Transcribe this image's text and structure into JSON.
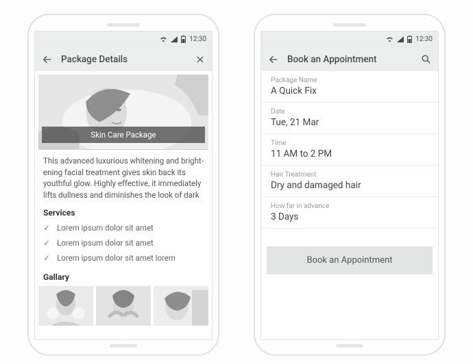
{
  "status": {
    "time": "12:30"
  },
  "left": {
    "appbar": {
      "title": "Package Details"
    },
    "hero": {
      "banner": "Skin Care Package"
    },
    "description": "This advanced luxurious whitening and bright-ening facial treatment gives skin back its youthful glow. Highly effective, it immediately lifts dullness and diminishes the look of dark",
    "services_heading": "Services",
    "services": [
      "Lorem ipsum dolor sit amet",
      "Lorem ipsum dolor sit amet",
      "Lorem ipsum dolor sit amet lorem"
    ],
    "gallery_heading": "Gallary"
  },
  "right": {
    "appbar": {
      "title": "Book an Appointment"
    },
    "fields": {
      "package": {
        "label": "Package Name",
        "value": "A Quick Fix"
      },
      "date": {
        "label": "Date",
        "value": "Tue, 21 Mar"
      },
      "time": {
        "label": "Time",
        "value": "11 AM to 2 PM"
      },
      "hair": {
        "label": "Hair Treatment",
        "value": "Dry and damaged hair"
      },
      "advance": {
        "label": "How far in advance",
        "value": "3 Days"
      }
    },
    "cta": "Book an Appointment"
  }
}
